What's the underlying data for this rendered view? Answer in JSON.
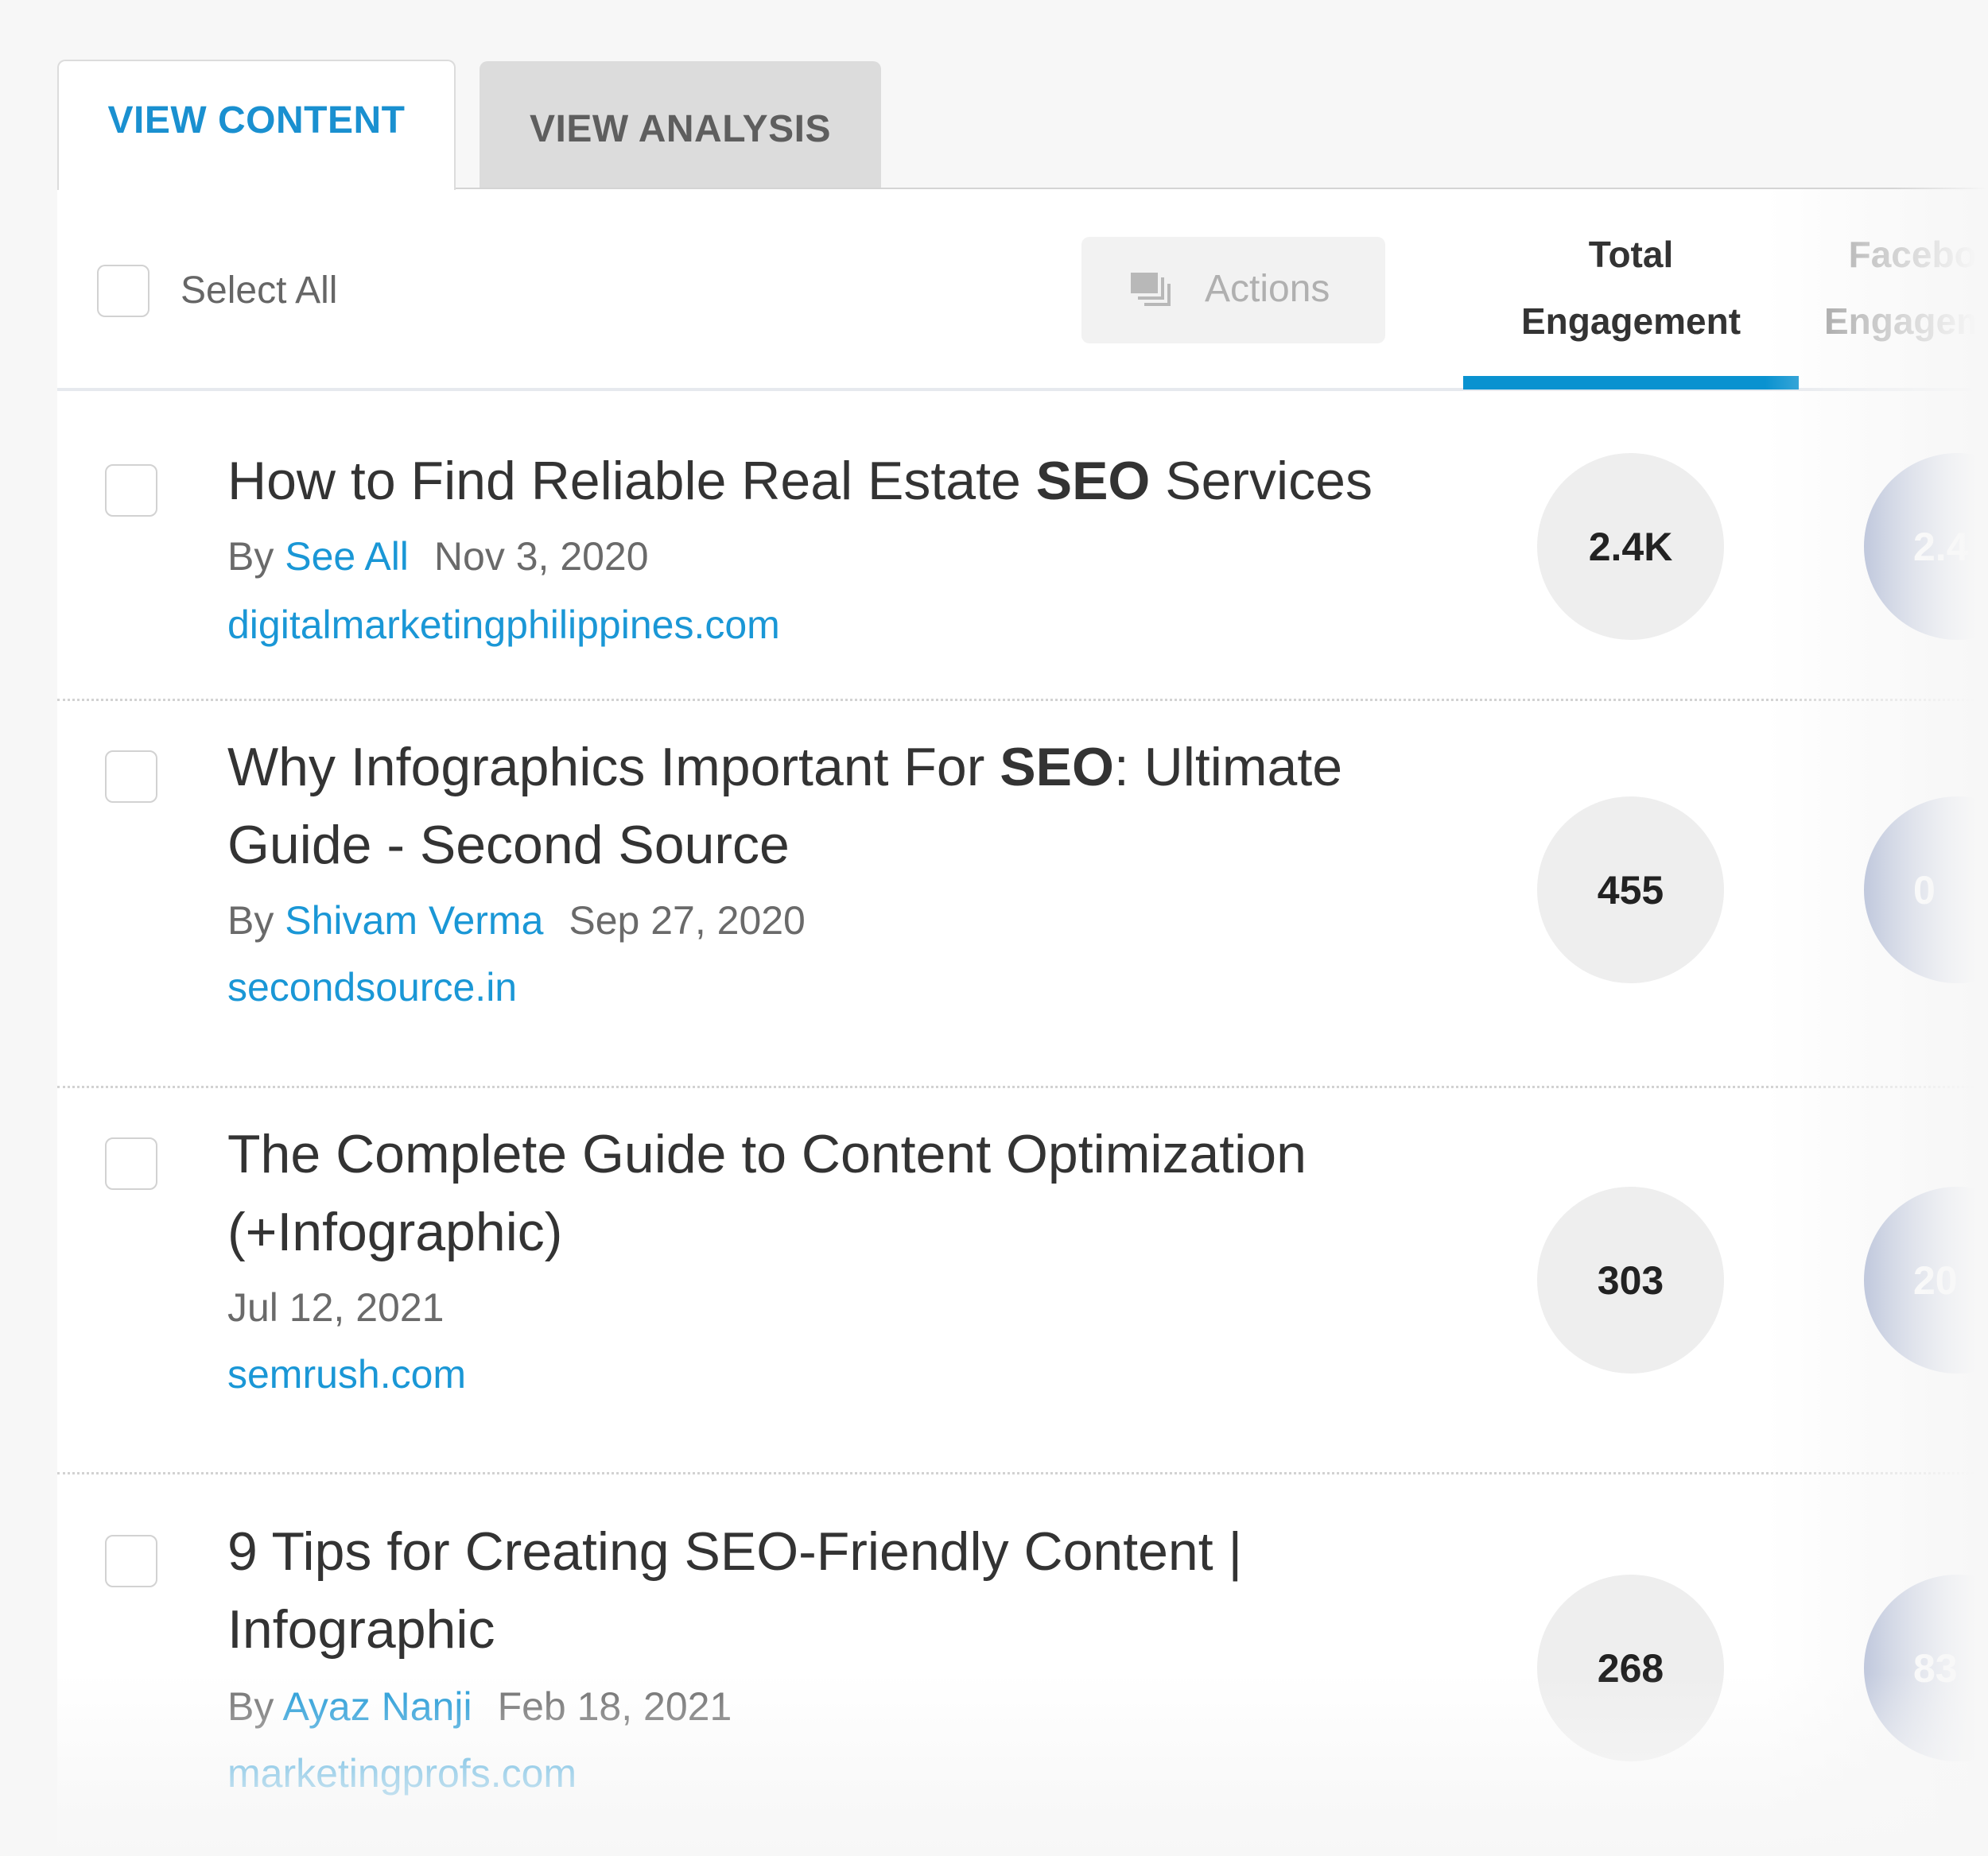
{
  "tabs": [
    {
      "label": "VIEW CONTENT",
      "active": true
    },
    {
      "label": "VIEW ANALYSIS",
      "active": false
    }
  ],
  "toolbar": {
    "select_all_label": "Select All",
    "select_all_checked": false,
    "actions_label": "Actions",
    "actions_icon": "stacked-layers-icon",
    "actions_enabled": false
  },
  "columns": [
    {
      "line1": "Total",
      "line2": "Engagement",
      "sorted": true
    },
    {
      "line1": "Facebook",
      "line2": "Engagement",
      "sorted": false,
      "visible_partial": "Faceb / Engage"
    }
  ],
  "colors": {
    "accent": "#0a92d0",
    "link": "#1a97d6",
    "facebook_circle": "#7e90bd"
  },
  "rows": [
    {
      "title_before": "How to Find Reliable Real Estate ",
      "title_bold": "SEO",
      "title_after": " Services",
      "by_prefix": "By ",
      "author": "See All",
      "date": "Nov 3, 2020",
      "domain": "digitalmarketingphilippines.com",
      "total_engagement": "2.4K",
      "facebook_engagement_partial": "2.4"
    },
    {
      "title_before": "Why Infographics Important For ",
      "title_bold": "SEO",
      "title_after": ": Ultimate Guide - Second Source",
      "by_prefix": "By ",
      "author": "Shivam Verma",
      "date": "Sep 27, 2020",
      "domain": "secondsource.in",
      "total_engagement": "455",
      "facebook_engagement_partial": "0"
    },
    {
      "title_before": "The Complete Guide to Content Optimization (+Infographic)",
      "title_bold": "",
      "title_after": "",
      "by_prefix": "",
      "author": "",
      "date": "Jul 12, 2021",
      "domain": "semrush.com",
      "total_engagement": "303",
      "facebook_engagement_partial": "20"
    },
    {
      "title_before": "9 Tips for Creating SEO-Friendly Content | Infographic",
      "title_bold": "",
      "title_after": "",
      "by_prefix": "By ",
      "author": "Ayaz Nanji",
      "date": "Feb 18, 2021",
      "domain": "marketingprofs.com",
      "total_engagement": "268",
      "facebook_engagement_partial": "83"
    }
  ]
}
